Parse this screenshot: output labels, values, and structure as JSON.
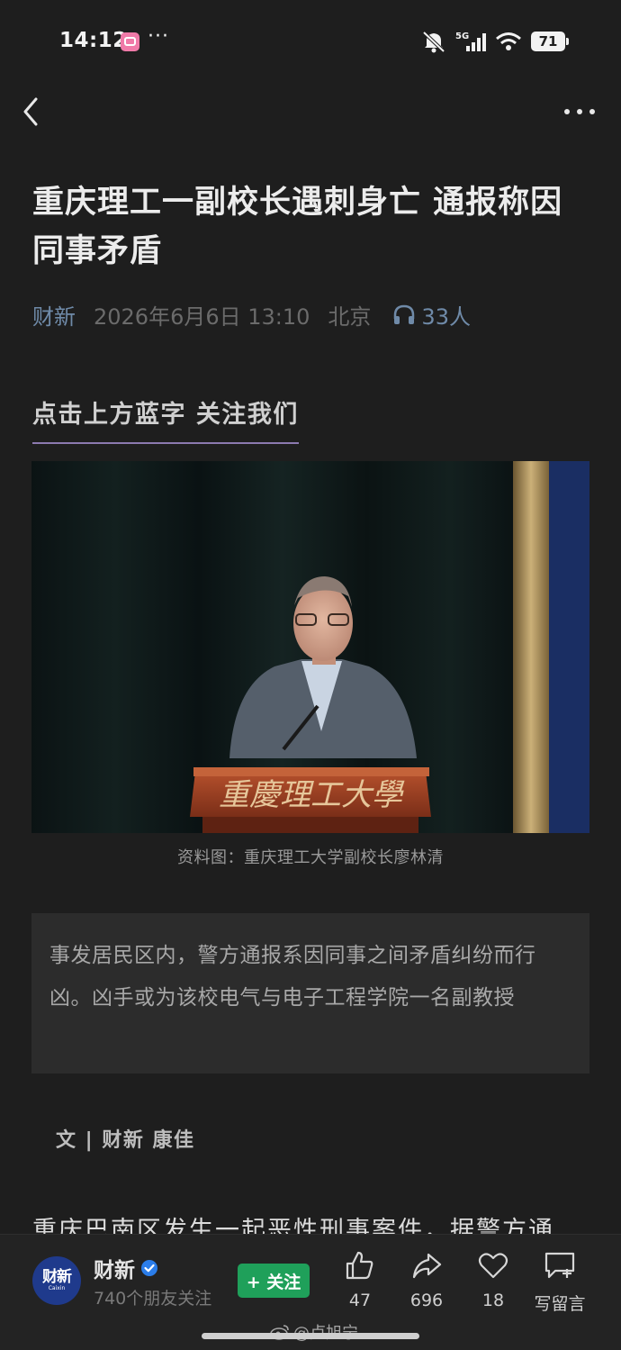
{
  "status_bar": {
    "time": "14:12",
    "dots": "···",
    "network": "5G",
    "battery": "71"
  },
  "article": {
    "title": "重庆理工一副校长遇刺身亡 通报称因同事矛盾",
    "source": "财新",
    "date": "2026年6月6日 13:10",
    "location": "北京",
    "listeners": "33人",
    "follow_prompt": "点击上方蓝字  关注我们",
    "photo_podium_text": "重慶理工大學",
    "photo_caption": "资料图：重庆理工大学副校长廖林清",
    "summary": "事发居民区内，警方通报系因同事之间矛盾纠纷而行凶。凶手或为该校电气与电子工程学院一名副教授",
    "byline": "文 | 财新 康佳",
    "body_first_line": "重庆巴南区发生一起恶性刑事案件，据警方通"
  },
  "bottom_bar": {
    "account_logo_main": "财新",
    "account_logo_sub": "Caixin",
    "account_name": "财新",
    "account_followers": "740个朋友关注",
    "follow_label": "+ 关注",
    "like_count": "47",
    "share_count": "696",
    "favorite_count": "18",
    "comment_label": "写留言"
  },
  "watermark": "@卢旭宁",
  "colors": {
    "background": "#1e1e1e",
    "accent_blue": "#6f8aa8",
    "follow_green": "#1fa05a",
    "underline_purple": "#8c7ab0"
  }
}
